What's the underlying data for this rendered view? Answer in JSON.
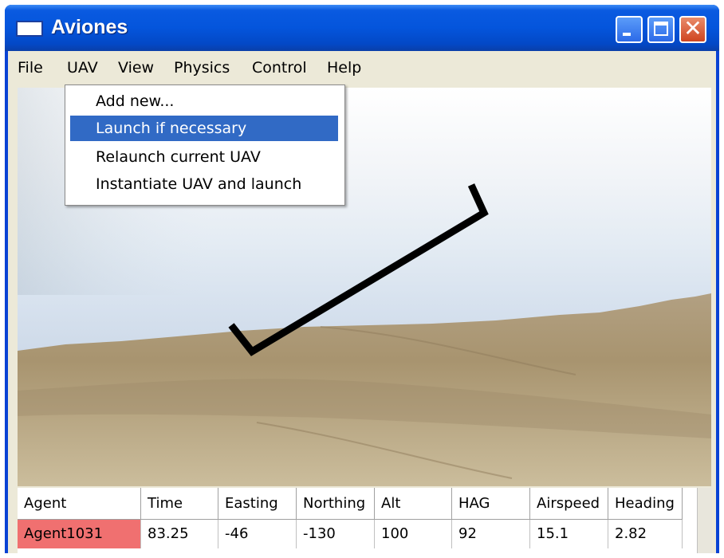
{
  "window": {
    "title": "Aviones",
    "icon": "app-window-icon",
    "controls": [
      "minimize-icon",
      "maximize-icon",
      "close-icon"
    ],
    "close_glyph": "✕"
  },
  "menubar": {
    "items": [
      {
        "label": "File"
      },
      {
        "label": "UAV"
      },
      {
        "label": "View"
      },
      {
        "label": "Physics"
      },
      {
        "label": "Control"
      },
      {
        "label": "Help"
      }
    ]
  },
  "uav_menu": {
    "items": [
      {
        "label": "Add new..."
      },
      {
        "label": "Launch if necessary",
        "selected": true
      },
      {
        "label": "Relaunch current UAV"
      },
      {
        "label": "Instantiate UAV and launch"
      }
    ]
  },
  "table": {
    "headers": [
      "Agent",
      "Time",
      "Easting",
      "Northing",
      "Alt",
      "HAG",
      "Airspeed",
      "Heading"
    ],
    "rows": [
      [
        "Agent1031",
        "83.25",
        "-46",
        "-130",
        "100",
        "92",
        "15.1",
        "2.82"
      ]
    ]
  },
  "colors": {
    "agent_highlight": "#f07070",
    "menu_selection": "#316ac5",
    "titlebar": "#0455dc"
  }
}
